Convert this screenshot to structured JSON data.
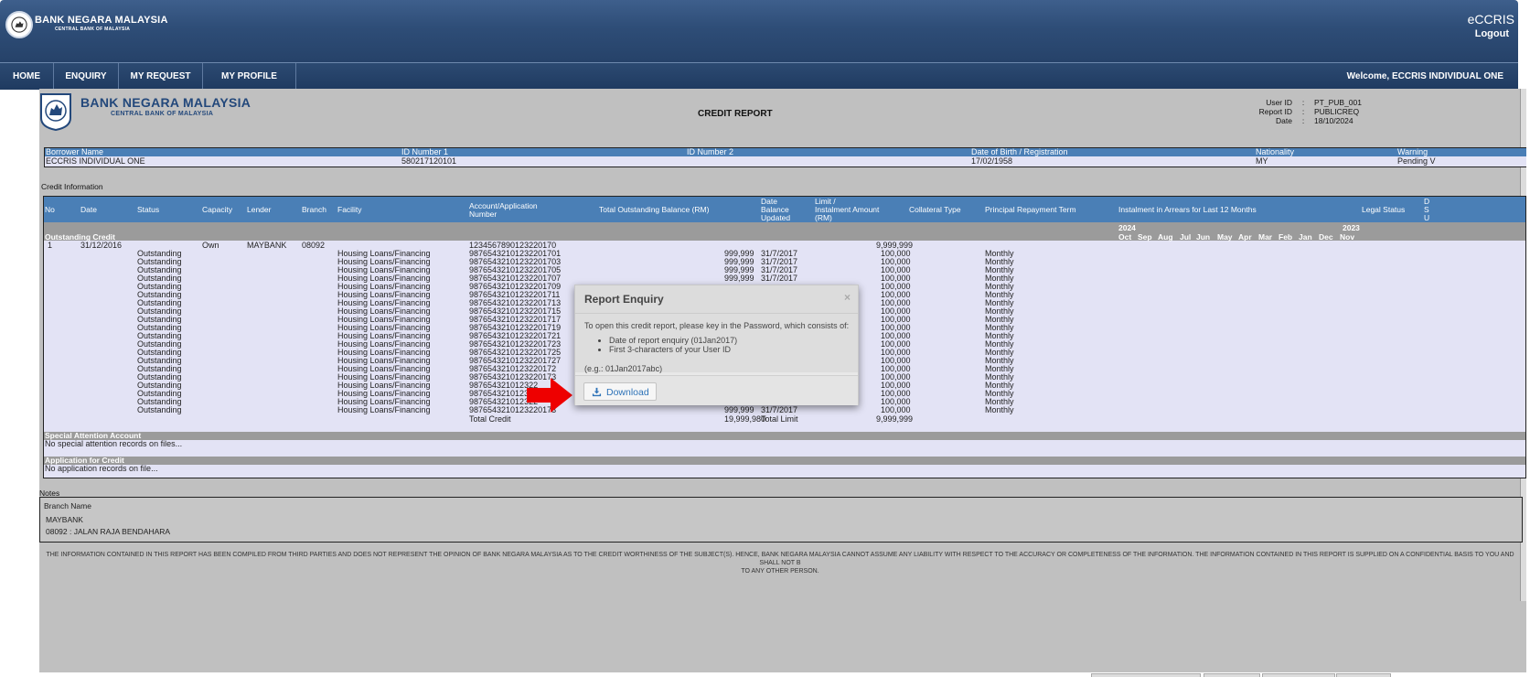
{
  "header": {
    "brand_name": "BANK NEGARA MALAYSIA",
    "brand_subtitle": "CENTRAL BANK OF MALAYSIA",
    "app_name": "eCCRIS",
    "logout_label": "Logout"
  },
  "nav": {
    "items": [
      {
        "label": "HOME"
      },
      {
        "label": "ENQUIRY"
      },
      {
        "label": "MY REQUEST"
      },
      {
        "label": "MY PROFILE"
      }
    ],
    "welcome": "Welcome, ECCRIS INDIVIDUAL ONE"
  },
  "report": {
    "brand_name": "BANK NEGARA MALAYSIA",
    "brand_subtitle": "CENTRAL BANK OF MALAYSIA",
    "title": "CREDIT REPORT",
    "meta": [
      {
        "key": "User ID",
        "sep": ":",
        "value": "PT_PUB_001"
      },
      {
        "key": "Report ID",
        "sep": ":",
        "value": "PUBLICREQ"
      },
      {
        "key": "Date",
        "sep": ":",
        "value": "18/10/2024"
      }
    ],
    "borrower": {
      "headers": [
        "Borrower Name",
        "ID Number 1",
        "ID Number 2",
        "Date of Birth / Registration",
        "Nationality",
        "Warning"
      ],
      "values": [
        "ECCRIS INDIVIDUAL ONE",
        "580217120101",
        "",
        "17/02/1958",
        "MY",
        "Pending V"
      ]
    },
    "credit_info_label": "Credit Information",
    "credit_headers": {
      "no": "No",
      "date": "Date",
      "status": "Status",
      "capacity": "Capacity",
      "lender": "Lender",
      "branch": "Branch",
      "facility": "Facility",
      "account_l1": "Account/Application",
      "account_l2": "Number",
      "balance": "Total Outstanding Balance (RM)",
      "date_bal_l1": "Date",
      "date_bal_l2": "Balance",
      "date_bal_l3": "Updated",
      "limit_l1": "Limit /",
      "limit_l2": "Instalment Amount",
      "limit_l3": "(RM)",
      "collateral": "Collateral Type",
      "repayment": "Principal Repayment Term",
      "arrears": "Instalment in Arrears for Last 12 Months",
      "legal": "Legal Status",
      "extra_l1": "D",
      "extra_l2": "S",
      "extra_l3": "U"
    },
    "outstanding_label": "Outstanding Credit",
    "years": {
      "y1": "2024",
      "y2": "2023"
    },
    "months": [
      "Oct",
      "Sep",
      "Aug",
      "Jul",
      "Jun",
      "May",
      "Apr",
      "Mar",
      "Feb",
      "Jan",
      "Dec",
      "Nov"
    ],
    "first_row": {
      "no": "1",
      "date": "31/12/2016",
      "capacity": "Own",
      "lender": "MAYBANK",
      "branch": "08092",
      "account": "1234567890123220170",
      "limit": "9,999,999"
    },
    "rows": [
      {
        "status": "Outstanding",
        "facility": "Housing Loans/Financing",
        "account": "98765432101232201701",
        "balance": "999,999",
        "date": "31/7/2017",
        "amount": "100,000",
        "term": "Monthly"
      },
      {
        "status": "Outstanding",
        "facility": "Housing Loans/Financing",
        "account": "98765432101232201703",
        "balance": "999,999",
        "date": "31/7/2017",
        "amount": "100,000",
        "term": "Monthly"
      },
      {
        "status": "Outstanding",
        "facility": "Housing Loans/Financing",
        "account": "98765432101232201705",
        "balance": "999,999",
        "date": "31/7/2017",
        "amount": "100,000",
        "term": "Monthly"
      },
      {
        "status": "Outstanding",
        "facility": "Housing Loans/Financing",
        "account": "98765432101232201707",
        "balance": "999,999",
        "date": "31/7/2017",
        "amount": "100,000",
        "term": "Monthly"
      },
      {
        "status": "Outstanding",
        "facility": "Housing Loans/Financing",
        "account": "98765432101232201709",
        "balance": "",
        "date": "",
        "amount": "100,000",
        "term": "Monthly"
      },
      {
        "status": "Outstanding",
        "facility": "Housing Loans/Financing",
        "account": "98765432101232201711",
        "balance": "",
        "date": "",
        "amount": "100,000",
        "term": "Monthly"
      },
      {
        "status": "Outstanding",
        "facility": "Housing Loans/Financing",
        "account": "98765432101232201713",
        "balance": "",
        "date": "",
        "amount": "100,000",
        "term": "Monthly"
      },
      {
        "status": "Outstanding",
        "facility": "Housing Loans/Financing",
        "account": "98765432101232201715",
        "balance": "",
        "date": "",
        "amount": "100,000",
        "term": "Monthly"
      },
      {
        "status": "Outstanding",
        "facility": "Housing Loans/Financing",
        "account": "98765432101232201717",
        "balance": "",
        "date": "",
        "amount": "100,000",
        "term": "Monthly"
      },
      {
        "status": "Outstanding",
        "facility": "Housing Loans/Financing",
        "account": "98765432101232201719",
        "balance": "",
        "date": "",
        "amount": "100,000",
        "term": "Monthly"
      },
      {
        "status": "Outstanding",
        "facility": "Housing Loans/Financing",
        "account": "98765432101232201721",
        "balance": "",
        "date": "",
        "amount": "100,000",
        "term": "Monthly"
      },
      {
        "status": "Outstanding",
        "facility": "Housing Loans/Financing",
        "account": "98765432101232201723",
        "balance": "",
        "date": "",
        "amount": "100,000",
        "term": "Monthly"
      },
      {
        "status": "Outstanding",
        "facility": "Housing Loans/Financing",
        "account": "98765432101232201725",
        "balance": "",
        "date": "",
        "amount": "100,000",
        "term": "Monthly"
      },
      {
        "status": "Outstanding",
        "facility": "Housing Loans/Financing",
        "account": "98765432101232201727",
        "balance": "",
        "date": "",
        "amount": "100,000",
        "term": "Monthly"
      },
      {
        "status": "Outstanding",
        "facility": "Housing Loans/Financing",
        "account": "9876543210123220172",
        "balance": "",
        "date": "",
        "amount": "100,000",
        "term": "Monthly"
      },
      {
        "status": "Outstanding",
        "facility": "Housing Loans/Financing",
        "account": "9876543210123220173",
        "balance": "",
        "date": "",
        "amount": "100,000",
        "term": "Monthly"
      },
      {
        "status": "Outstanding",
        "facility": "Housing Loans/Financing",
        "account": "987654321012322",
        "balance": "",
        "date": "",
        "amount": "100,000",
        "term": "Monthly"
      },
      {
        "status": "Outstanding",
        "facility": "Housing Loans/Financing",
        "account": "987654321012322",
        "balance": "",
        "date": "",
        "amount": "100,000",
        "term": "Monthly"
      },
      {
        "status": "Outstanding",
        "facility": "Housing Loans/Financing",
        "account": "987654321012322",
        "balance": "",
        "date": "",
        "amount": "100,000",
        "term": "Monthly"
      },
      {
        "status": "Outstanding",
        "facility": "Housing Loans/Financing",
        "account": "9876543210123220173",
        "balance": "999,999",
        "date": "31/7/2017",
        "amount": "100,000",
        "term": "Monthly"
      }
    ],
    "total": {
      "label": "Total Credit",
      "balance": "19,999,980",
      "limit_label": "Total Limit",
      "limit": "9,999,999"
    },
    "special_label": "Special Attention Account",
    "special_empty": "No special attention records on files...",
    "application_label": "Application for Credit",
    "application_empty": "No application records on file...",
    "notes_label": "Notes",
    "notes": {
      "branch_header": "Branch Name",
      "lender": "MAYBANK",
      "branch": "08092 : JALAN RAJA BENDAHARA"
    },
    "disclaimer_l1": "THE INFORMATION CONTAINED IN THIS REPORT HAS BEEN COMPILED FROM THIRD PARTIES AND DOES NOT REPRESENT THE OPINION OF BANK NEGARA MALAYSIA AS TO THE CREDIT WORTHINESS OF THE SUBJECT(S). HENCE, BANK NEGARA MALAYSIA CANNOT ASSUME ANY LIABILITY WITH RESPECT TO THE ACCURACY OR COMPLETENESS OF THE INFORMATION. THE INFORMATION CONTAINED IN THIS REPORT IS SUPPLIED ON A CONFIDENTIAL BASIS TO YOU AND SHALL NOT B",
    "disclaimer_l2": "TO ANY OTHER PERSON."
  },
  "modal": {
    "title": "Report Enquiry",
    "close": "×",
    "intro": "To open this credit report, please key in the Password, which consists of:",
    "items": [
      "Date of report enquiry (01Jan2017)",
      "First 3-characters of your User ID"
    ],
    "example": "(e.g.: 01Jan2017abc)",
    "download_label": "Download"
  },
  "icons": {
    "download": "download-icon",
    "close": "close-icon",
    "arrow": "arrow-right-icon"
  },
  "colors": {
    "header_blue": "#2e4d77",
    "table_blue": "#4a7fb6",
    "row_bg": "#e3e3f5",
    "arrow_red": "#ee0000",
    "link_blue": "#2e73b8"
  }
}
